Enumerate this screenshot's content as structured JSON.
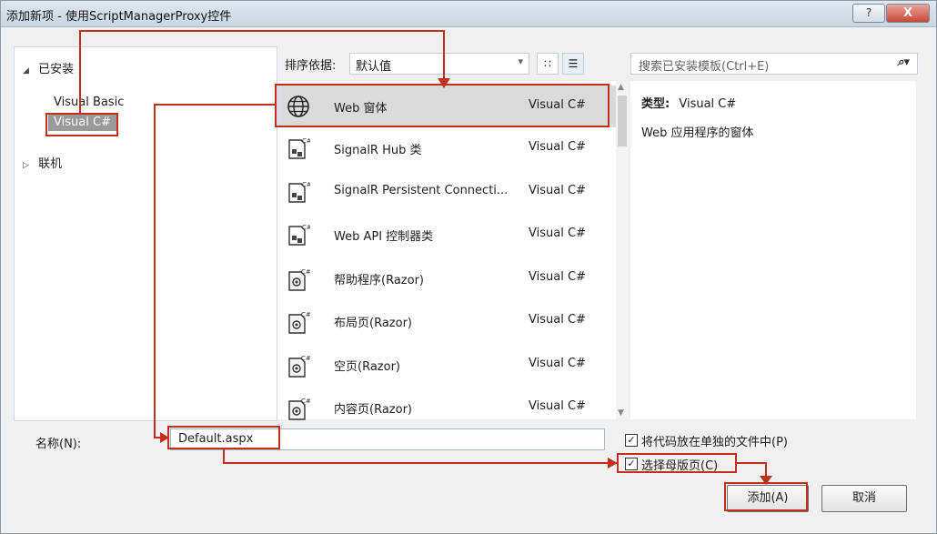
{
  "window": {
    "title": "添加新项 - 使用ScriptManagerProxy控件",
    "help_glyph": "?",
    "close_glyph": "X"
  },
  "left": {
    "installed": "已安装",
    "items": [
      "Visual Basic",
      "Visual C#"
    ],
    "online": "联机"
  },
  "center": {
    "sort_label": "排序依据:",
    "sort_value": "默认值",
    "templates": [
      {
        "name": "Web 窗体",
        "lang": "Visual C#",
        "icon": "globe-icon"
      },
      {
        "name": "SignalR Hub 类",
        "lang": "Visual C#",
        "icon": "csharp-class-icon"
      },
      {
        "name": "SignalR Persistent Connecti...",
        "lang": "Visual C#",
        "icon": "csharp-class-icon"
      },
      {
        "name": "Web API 控制器类",
        "lang": "Visual C#",
        "icon": "csharp-class-icon"
      },
      {
        "name": "帮助程序(Razor)",
        "lang": "Visual C#",
        "icon": "razor-page-icon"
      },
      {
        "name": "布局页(Razor)",
        "lang": "Visual C#",
        "icon": "razor-page-icon"
      },
      {
        "name": "空页(Razor)",
        "lang": "Visual C#",
        "icon": "razor-page-icon"
      },
      {
        "name": "内容页(Razor)",
        "lang": "Visual C#",
        "icon": "razor-page-icon"
      }
    ]
  },
  "right": {
    "search_placeholder": "搜索已安装模板(Ctrl+E)",
    "type_label": "类型:",
    "type_value": "Visual C#",
    "description": "Web 应用程序的窗体"
  },
  "bottom": {
    "name_label": "名称(N):",
    "name_value": "Default.aspx",
    "separate_file_label": "将代码放在单独的文件中(P)",
    "master_page_label": "选择母版页(C)",
    "add_button": "添加(A)",
    "cancel_button": "取消"
  },
  "colors": {
    "annotation": "#c0301e",
    "selected_row": "#dadada"
  }
}
